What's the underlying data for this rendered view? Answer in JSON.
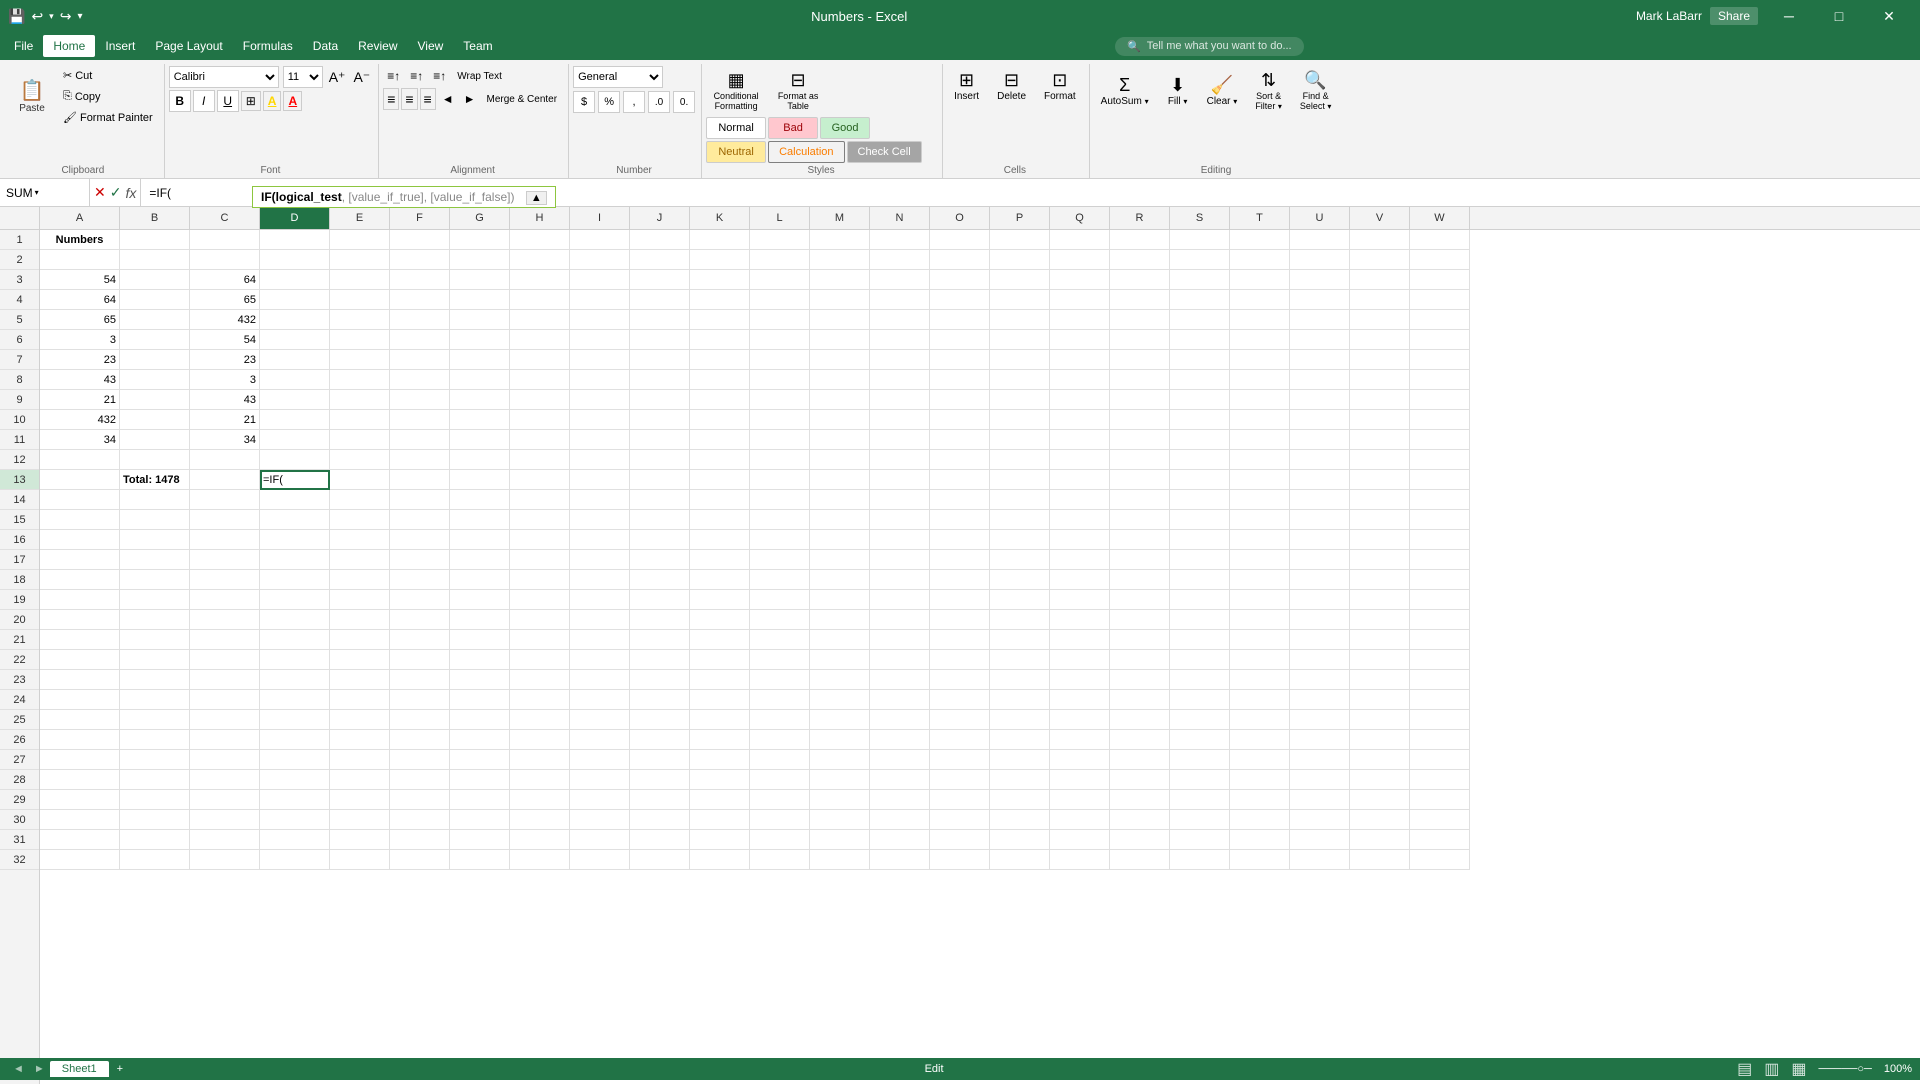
{
  "titleBar": {
    "title": "Numbers - Excel",
    "saveIcon": "💾",
    "undoIcon": "↩",
    "redoIcon": "↪",
    "minimizeIcon": "─",
    "maximizeIcon": "□",
    "closeIcon": "✕",
    "userLabel": "Mark LaBarr",
    "shareLabel": "Share"
  },
  "menuBar": {
    "items": [
      "File",
      "Home",
      "Insert",
      "Page Layout",
      "Formulas",
      "Data",
      "Review",
      "View",
      "Team"
    ],
    "activeIndex": 1,
    "searchPlaceholder": "Tell me what you want to do..."
  },
  "ribbon": {
    "clipboard": {
      "label": "Clipboard",
      "paste": "Paste",
      "cut": "Cut",
      "copy": "Copy",
      "formatPainter": "Format Painter"
    },
    "font": {
      "label": "Font",
      "fontName": "Calibri",
      "fontSize": "11",
      "bold": "B",
      "italic": "I",
      "underline": "U",
      "borders": "⊞",
      "fillColor": "A",
      "fontColor": "A"
    },
    "alignment": {
      "label": "Alignment",
      "wrapText": "Wrap Text",
      "mergeCenter": "Merge & Center"
    },
    "number": {
      "label": "Number",
      "format": "General",
      "currency": "$",
      "percent": "%",
      "comma": ","
    },
    "styles": {
      "label": "Styles",
      "conditionalFormatting": "Conditional Formatting",
      "formatAsTable": "Format as Table",
      "normal": "Normal",
      "bad": "Bad",
      "good": "Good",
      "neutral": "Neutral",
      "calculation": "Calculation",
      "checkCell": "Check Cell"
    },
    "cells": {
      "label": "Cells",
      "insert": "Insert",
      "delete": "Delete",
      "format": "Format"
    },
    "editing": {
      "label": "Editing",
      "autoSum": "AutoSum",
      "fill": "Fill",
      "clear": "Clear",
      "sortFilter": "Sort & Filter",
      "findSelect": "Find & Select"
    }
  },
  "formulaBar": {
    "nameBox": "SUM",
    "cancelBtn": "✕",
    "confirmBtn": "✓",
    "funcBtn": "fx",
    "formula": "=IF("
  },
  "tooltip": {
    "funcName": "IF",
    "args": "logical_test, [value_if_true], [value_if_false]",
    "bold_arg": "logical_test"
  },
  "spreadsheet": {
    "columns": [
      "A",
      "B",
      "C",
      "D",
      "E",
      "F",
      "G",
      "H",
      "I",
      "J",
      "K",
      "L",
      "M",
      "N",
      "O",
      "P",
      "Q",
      "R",
      "S",
      "T",
      "U",
      "V",
      "W"
    ],
    "activeCell": "D13",
    "activeCellContent": "=IF(",
    "rows": [
      {
        "rowNum": 1,
        "cells": {
          "A": "Numbers",
          "B": "",
          "C": "",
          "D": "",
          "E": ""
        }
      },
      {
        "rowNum": 2,
        "cells": {
          "A": "",
          "B": "",
          "C": "",
          "D": "",
          "E": ""
        }
      },
      {
        "rowNum": 3,
        "cells": {
          "A": "54",
          "B": "",
          "C": "64",
          "D": "",
          "E": ""
        }
      },
      {
        "rowNum": 4,
        "cells": {
          "A": "64",
          "B": "",
          "C": "65",
          "D": "",
          "E": ""
        }
      },
      {
        "rowNum": 5,
        "cells": {
          "A": "65",
          "B": "",
          "C": "432",
          "D": "",
          "E": ""
        }
      },
      {
        "rowNum": 6,
        "cells": {
          "A": "3",
          "B": "",
          "C": "54",
          "D": "",
          "E": ""
        }
      },
      {
        "rowNum": 7,
        "cells": {
          "A": "23",
          "B": "",
          "C": "23",
          "D": "",
          "E": ""
        }
      },
      {
        "rowNum": 8,
        "cells": {
          "A": "43",
          "B": "",
          "C": "3",
          "D": "",
          "E": ""
        }
      },
      {
        "rowNum": 9,
        "cells": {
          "A": "21",
          "B": "",
          "C": "43",
          "D": "",
          "E": ""
        }
      },
      {
        "rowNum": 10,
        "cells": {
          "A": "432",
          "B": "",
          "C": "21",
          "D": "",
          "E": ""
        }
      },
      {
        "rowNum": 11,
        "cells": {
          "A": "34",
          "B": "",
          "C": "34",
          "D": "",
          "E": ""
        }
      },
      {
        "rowNum": 12,
        "cells": {
          "A": "",
          "B": "",
          "C": "",
          "D": "",
          "E": ""
        }
      },
      {
        "rowNum": 13,
        "cells": {
          "A": "",
          "B": "Total: 1478",
          "C": "",
          "D": "=IF(",
          "E": ""
        }
      },
      {
        "rowNum": 14,
        "cells": {
          "A": "",
          "B": "",
          "C": "",
          "D": "",
          "E": ""
        }
      },
      {
        "rowNum": 15,
        "cells": {
          "A": "",
          "B": "",
          "C": "",
          "D": "",
          "E": ""
        }
      },
      {
        "rowNum": 16,
        "cells": {
          "A": "",
          "B": "",
          "C": "",
          "D": "",
          "E": ""
        }
      },
      {
        "rowNum": 17,
        "cells": {
          "A": "",
          "B": "",
          "C": "",
          "D": "",
          "E": ""
        }
      },
      {
        "rowNum": 18,
        "cells": {
          "A": "",
          "B": "",
          "C": "",
          "D": "",
          "E": ""
        }
      },
      {
        "rowNum": 19,
        "cells": {
          "A": "",
          "B": "",
          "C": "",
          "D": "",
          "E": ""
        }
      },
      {
        "rowNum": 20,
        "cells": {
          "A": "",
          "B": "",
          "C": "",
          "D": "",
          "E": ""
        }
      },
      {
        "rowNum": 21,
        "cells": {
          "A": "",
          "B": "",
          "C": "",
          "D": "",
          "E": ""
        }
      },
      {
        "rowNum": 22,
        "cells": {
          "A": "",
          "B": "",
          "C": "",
          "D": "",
          "E": ""
        }
      },
      {
        "rowNum": 23,
        "cells": {
          "A": "",
          "B": "",
          "C": "",
          "D": "",
          "E": ""
        }
      },
      {
        "rowNum": 24,
        "cells": {
          "A": "",
          "B": "",
          "C": "",
          "D": "",
          "E": ""
        }
      },
      {
        "rowNum": 25,
        "cells": {
          "A": "",
          "B": "",
          "C": "",
          "D": "",
          "E": ""
        }
      },
      {
        "rowNum": 26,
        "cells": {
          "A": "",
          "B": "",
          "C": "",
          "D": "",
          "E": ""
        }
      },
      {
        "rowNum": 27,
        "cells": {
          "A": "",
          "B": "",
          "C": "",
          "D": "",
          "E": ""
        }
      },
      {
        "rowNum": 28,
        "cells": {
          "A": "",
          "B": "",
          "C": "",
          "D": "",
          "E": ""
        }
      },
      {
        "rowNum": 29,
        "cells": {
          "A": "",
          "B": "",
          "C": "",
          "D": "",
          "E": ""
        }
      },
      {
        "rowNum": 30,
        "cells": {
          "A": "",
          "B": "",
          "C": "",
          "D": "",
          "E": ""
        }
      },
      {
        "rowNum": 31,
        "cells": {
          "A": "",
          "B": "",
          "C": "",
          "D": "",
          "E": ""
        }
      },
      {
        "rowNum": 32,
        "cells": {
          "A": "",
          "B": "",
          "C": "",
          "D": "",
          "E": ""
        }
      }
    ]
  },
  "statusBar": {
    "mode": "Edit",
    "sheetTabs": [
      "Sheet1"
    ],
    "addSheet": "+",
    "viewNormal": "▤",
    "viewPage": "▥",
    "viewPreview": "▦",
    "zoomLevel": "100%"
  }
}
